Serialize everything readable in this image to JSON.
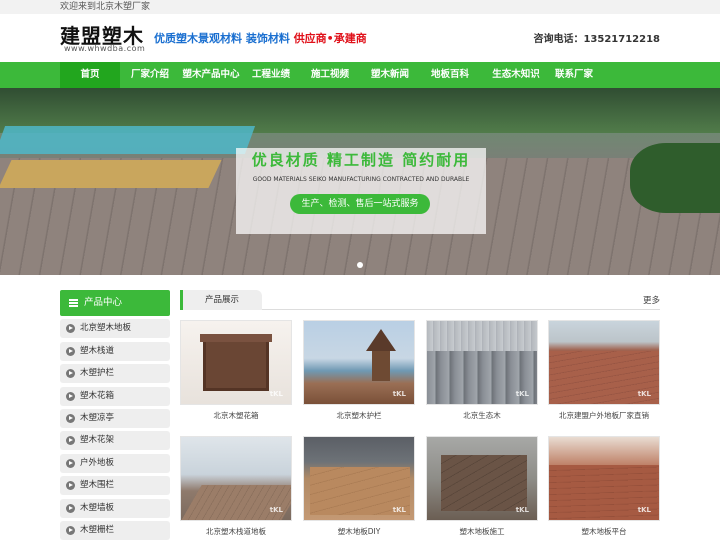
{
  "topbar": {
    "welcome": "欢迎来到北京木塑厂家"
  },
  "header": {
    "logo_text": "建盟塑木",
    "logo_url": "www.whwdba.com",
    "slogan_part1": "优质塑木景观材料 装饰材料",
    "slogan_part2": "供应商•承建商",
    "phone": "咨询电话：13521712218"
  },
  "nav": {
    "items": [
      {
        "label": "首页",
        "active": true
      },
      {
        "label": "厂家介绍"
      },
      {
        "label": "塑木产品中心"
      },
      {
        "label": "工程业绩"
      },
      {
        "label": "施工视频"
      },
      {
        "label": "塑木新闻"
      },
      {
        "label": "地板百科"
      },
      {
        "label": "生态木知识"
      },
      {
        "label": "联系厂家"
      }
    ]
  },
  "banner": {
    "headline": "优良材质 精工制造 简约耐用",
    "subtext": "GOOD MATERIALS SEIKO MANUFACTURING CONTRACTED AND DURABLE",
    "button": "生产、检测、售后一站式服务"
  },
  "sidebar": {
    "title": "产品中心",
    "items": [
      "北京塑木地板",
      "塑木栈道",
      "木塑护栏",
      "塑木花箱",
      "木塑凉亭",
      "塑木花架",
      "户外地板",
      "塑木围栏",
      "木塑墙板",
      "木塑栅栏"
    ]
  },
  "products": {
    "tab": "产品展示",
    "more": "更多",
    "watermark": "tKL",
    "items": [
      {
        "caption": "北京木塑花箱",
        "image": "planter-box"
      },
      {
        "caption": "北京塑木护栏",
        "image": "railing-pavilion"
      },
      {
        "caption": "北京生态木",
        "image": "wpc-profiles"
      },
      {
        "caption": "北京建盟户外地板厂家直销",
        "image": "outdoor-deck"
      },
      {
        "caption": "北京塑木栈道地板",
        "image": "boardwalk"
      },
      {
        "caption": "塑木地板DIY",
        "image": "diy-deck"
      },
      {
        "caption": "塑木地板施工",
        "image": "installation"
      },
      {
        "caption": "塑木地板平台",
        "image": "deck-platform"
      }
    ]
  },
  "colors": {
    "brand_green": "#3cb93a",
    "accent_red": "#e0111a",
    "accent_blue": "#1a6fd0"
  }
}
